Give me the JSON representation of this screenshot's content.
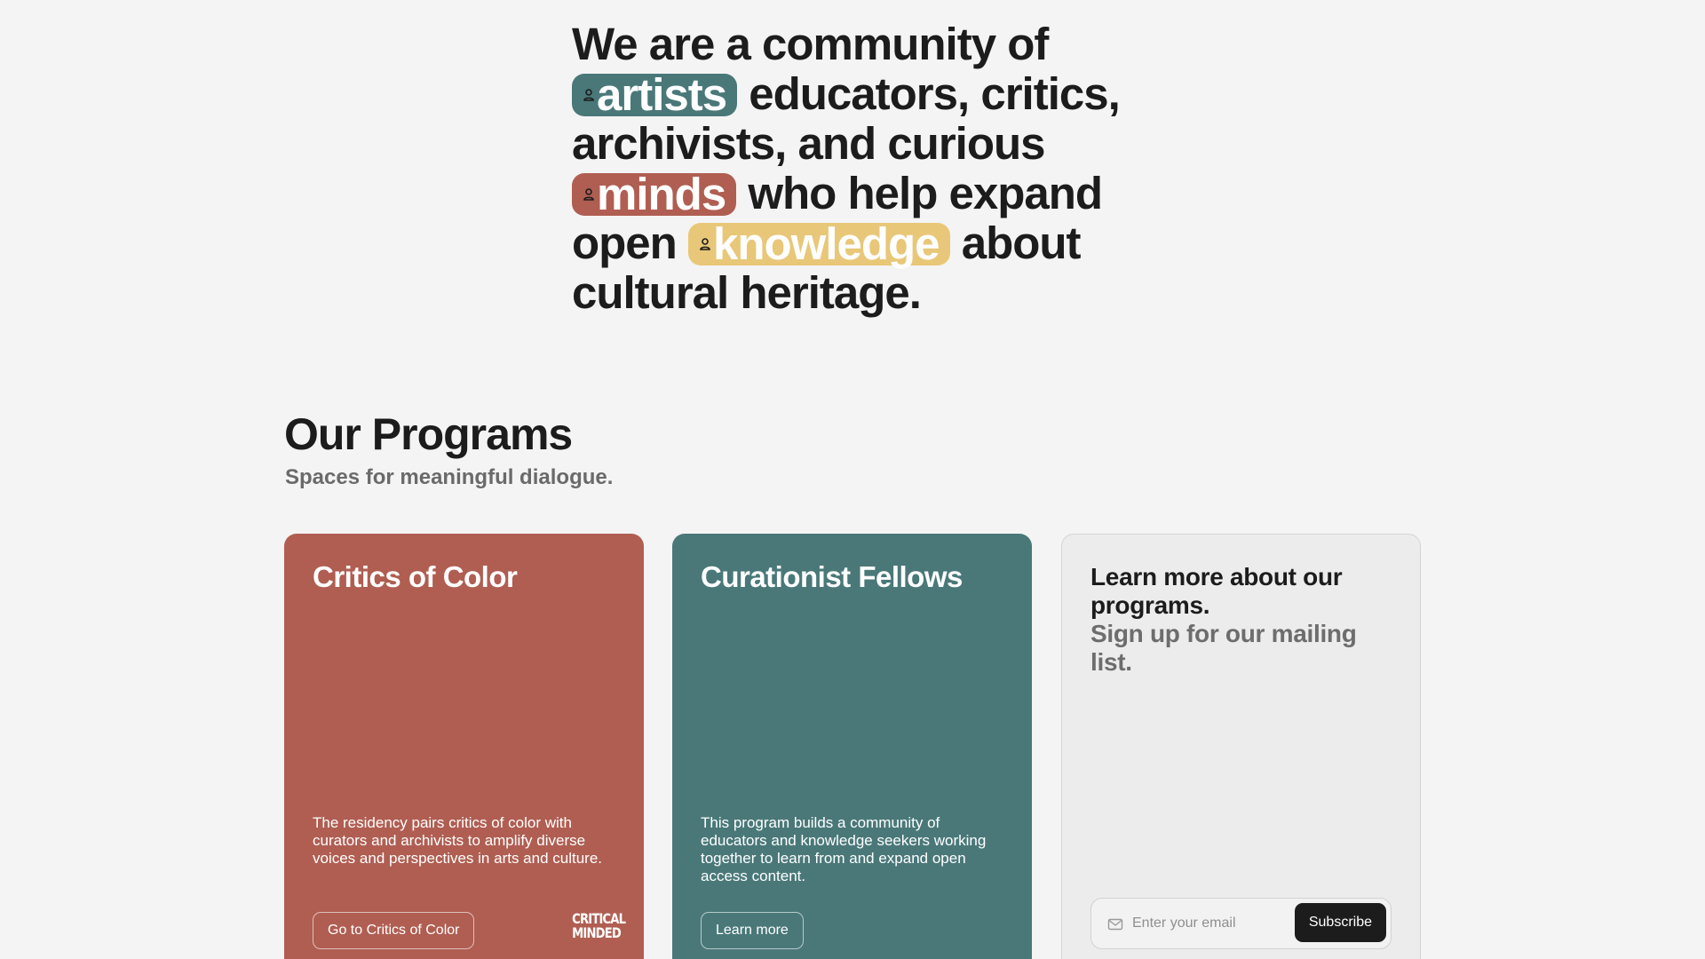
{
  "hero": {
    "line1": "We are a community of",
    "pill_artists": "artists",
    "text_after_artists": " educators, critics,",
    "line3": "archivists, and curious",
    "pill_minds": "minds",
    "text_after_minds": " who help expand",
    "text_before_knowledge": "open ",
    "pill_knowledge": "knowledge",
    "text_after_knowledge": " about",
    "line6": "cultural heritage.",
    "pill_icon": "person-icon"
  },
  "programs": {
    "title": "Our Programs",
    "subtitle": "Spaces for meaningful dialogue.",
    "cards": [
      {
        "title": "Critics of Color",
        "description": "The residency pairs critics of color with curators and archivists to amplify diverse voices and perspectives in arts and culture.",
        "button_label": "Go to Critics of Color",
        "logo_line1": "CRITICAL",
        "logo_line2": "MINDED"
      },
      {
        "title": "Curationist Fellows",
        "description": "This program builds a community of educators and knowledge seekers working together to learn from and expand open access content.",
        "button_label": "Learn more"
      }
    ],
    "signup": {
      "title": "Learn more about our programs.",
      "subtitle": "Sign up for our mailing list.",
      "email_placeholder": "Enter your email",
      "subscribe_label": "Subscribe",
      "icon": "mail-icon"
    }
  },
  "colors": {
    "teal": "#4a7879",
    "red": "#b05e52",
    "yellow": "#e8c778",
    "dark": "#1c1c1c",
    "background": "#f4f4f4"
  }
}
